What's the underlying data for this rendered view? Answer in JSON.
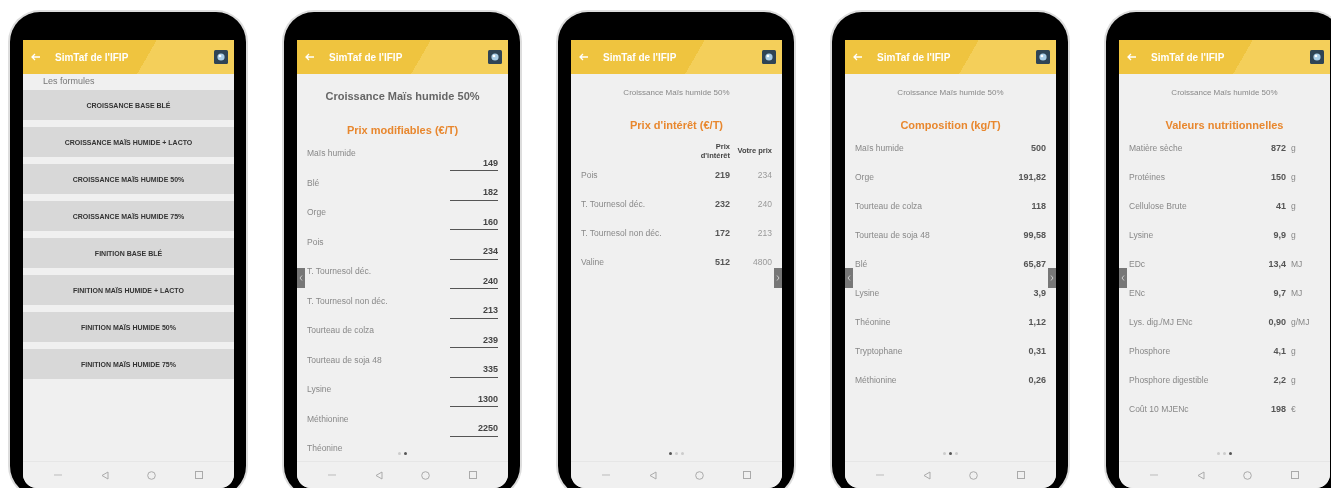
{
  "phones": [
    {
      "kind": "formula-list",
      "app_title": "SimTaf de l'IFIP",
      "section_label": "Les formules",
      "left_arrow": false,
      "right_arrow": false,
      "formulas": [
        "CROISSANCE BASE BLÉ",
        "CROISSANCE MAÏS HUMIDE + LACTO",
        "CROISSANCE MAÏS HUMIDE 50%",
        "CROISSANCE MAÏS HUMIDE 75%",
        "FINITION BASE BLÉ",
        "FINITION MAÏS HUMIDE + LACTO",
        "FINITION MAÏS HUMIDE 50%",
        "FINITION MAÏS HUMIDE 75%"
      ]
    },
    {
      "kind": "price-form",
      "app_title": "SimTaf de l'IFIP",
      "subtitle": "Croissance Maïs humide 50%",
      "heading": "Prix modifiables (€/T)",
      "left_arrow": true,
      "right_arrow": false,
      "dots": [
        {
          "selected": false
        },
        {
          "selected": true
        }
      ],
      "fields": [
        {
          "label": "Maïs humide",
          "value": "149"
        },
        {
          "label": "Blé",
          "value": "182"
        },
        {
          "label": "Orge",
          "value": "160"
        },
        {
          "label": "Pois",
          "value": "234"
        },
        {
          "label": "T. Tournesol déc.",
          "value": "240"
        },
        {
          "label": "T. Tournesol non déc.",
          "value": "213"
        },
        {
          "label": "Tourteau de colza",
          "value": "239"
        },
        {
          "label": "Tourteau de soja 48",
          "value": "335"
        },
        {
          "label": "Lysine",
          "value": "1300"
        },
        {
          "label": "Méthionine",
          "value": "2250"
        },
        {
          "label": "Théonine"
        }
      ]
    },
    {
      "kind": "price-table",
      "app_title": "SimTaf de l'IFIP",
      "subtitle": "Croissance Maïs humide 50%",
      "heading": "Prix d'intérêt (€/T)",
      "left_arrow": false,
      "right_arrow": true,
      "dots": [
        {
          "selected": true
        },
        {
          "selected": false
        },
        {
          "selected": false
        }
      ],
      "columns": [
        "Prix d'intérêt",
        "Votre prix"
      ],
      "rows": [
        {
          "label": "Pois",
          "interest": "219",
          "yours": "234"
        },
        {
          "label": "T. Tournesol déc.",
          "interest": "232",
          "yours": "240"
        },
        {
          "label": "T. Tournesol non déc.",
          "interest": "172",
          "yours": "213"
        },
        {
          "label": "Valine",
          "interest": "512",
          "yours": "4800"
        }
      ]
    },
    {
      "kind": "value-list",
      "app_title": "SimTaf de l'IFIP",
      "subtitle": "Croissance Maïs humide 50%",
      "heading": "Composition (kg/T)",
      "left_arrow": true,
      "right_arrow": true,
      "dots": [
        {
          "selected": false
        },
        {
          "selected": true
        },
        {
          "selected": false
        }
      ],
      "rows": [
        {
          "label": "Maïs humide",
          "value": "500"
        },
        {
          "label": "Orge",
          "value": "191,82"
        },
        {
          "label": "Tourteau de colza",
          "value": "118"
        },
        {
          "label": "Tourteau de soja 48",
          "value": "99,58"
        },
        {
          "label": "Blé",
          "value": "65,87"
        },
        {
          "label": "Lysine",
          "value": "3,9"
        },
        {
          "label": "Théonine",
          "value": "1,12"
        },
        {
          "label": "Tryptophane",
          "value": "0,31"
        },
        {
          "label": "Méthionine",
          "value": "0,26"
        }
      ]
    },
    {
      "kind": "value-list",
      "app_title": "SimTaf de l'IFIP",
      "subtitle": "Croissance Maïs humide 50%",
      "heading": "Valeurs nutritionnelles",
      "left_arrow": true,
      "right_arrow": false,
      "dots": [
        {
          "selected": false
        },
        {
          "selected": false
        },
        {
          "selected": true
        }
      ],
      "rows": [
        {
          "label": "Matière sèche",
          "value": "872",
          "unit": "g"
        },
        {
          "label": "Protéines",
          "value": "150",
          "unit": "g"
        },
        {
          "label": "Cellulose Brute",
          "value": "41",
          "unit": "g"
        },
        {
          "label": "Lysine",
          "value": "9,9",
          "unit": "g"
        },
        {
          "label": "EDc",
          "value": "13,4",
          "unit": "MJ"
        },
        {
          "label": "ENc",
          "value": "9,7",
          "unit": "MJ"
        },
        {
          "label": "Lys. dig./MJ ENc",
          "value": "0,90",
          "unit": "g/MJ"
        },
        {
          "label": "Phosphore",
          "value": "4,1",
          "unit": "g"
        },
        {
          "label": "Phosphore digestible",
          "value": "2,2",
          "unit": "g"
        },
        {
          "label": "Coût 10 MJENc",
          "value": "198",
          "unit": "€"
        }
      ]
    }
  ]
}
